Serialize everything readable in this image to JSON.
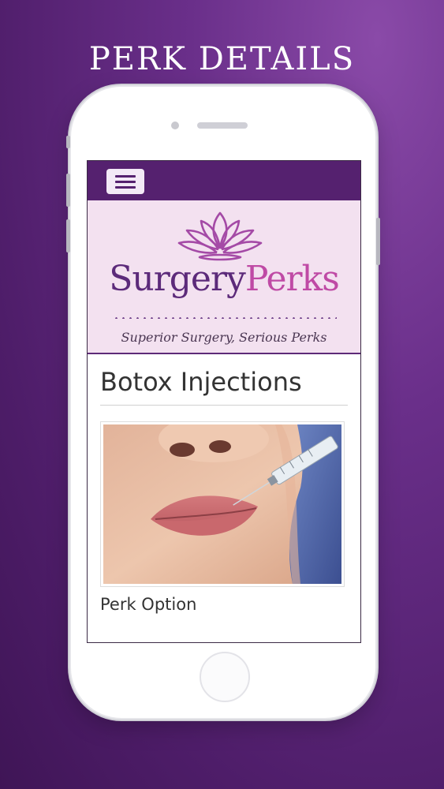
{
  "headline": "PERK DETAILS",
  "app": {
    "menu_icon": "hamburger-menu-icon",
    "brand": {
      "name_part1": "Surgery",
      "name_part2": "Perks",
      "tagline": "Superior Surgery, Serious Perks",
      "logo_icon": "lotus-icon"
    },
    "colors": {
      "header": "#55216f",
      "brand_bg": "#f3e1f0",
      "brand_purple": "#5c2a7a",
      "brand_pink": "#bf4aa5"
    }
  },
  "page": {
    "title": "Botox Injections",
    "image_icon": "botox-injection-photo",
    "option_label": "Perk Option"
  }
}
